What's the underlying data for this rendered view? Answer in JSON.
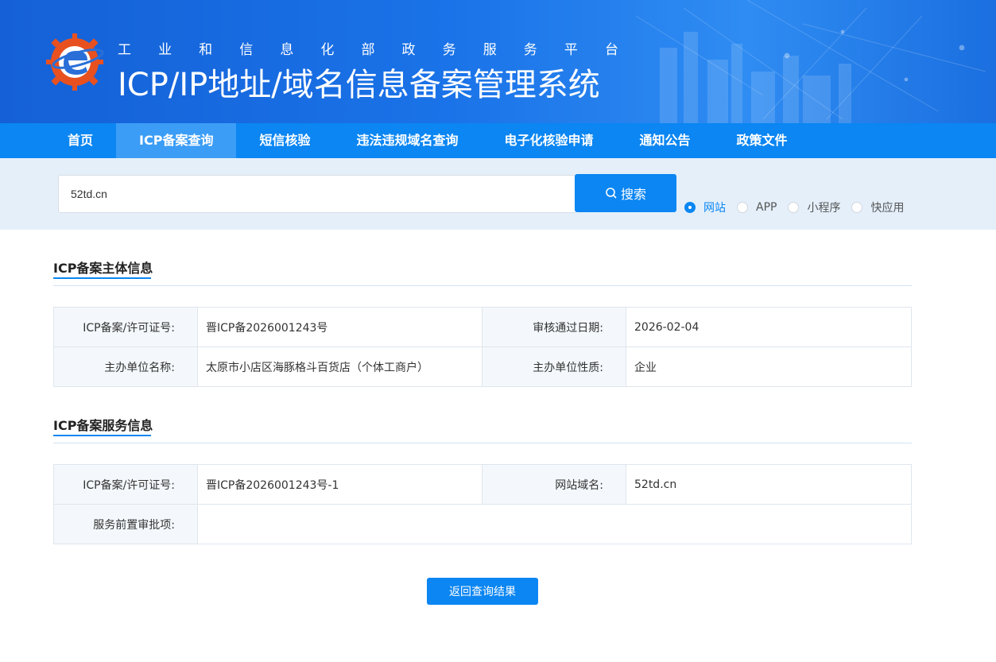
{
  "header": {
    "subtitle_chars": [
      "工",
      "业",
      "和",
      "信",
      "息",
      "化",
      "部",
      "政",
      "务",
      "服",
      "务",
      "平",
      "台"
    ],
    "title": "ICP/IP地址/域名信息备案管理系统"
  },
  "nav": {
    "items": [
      {
        "label": "首页",
        "active": false
      },
      {
        "label": "ICP备案查询",
        "active": true
      },
      {
        "label": "短信核验",
        "active": false
      },
      {
        "label": "违法违规域名查询",
        "active": false
      },
      {
        "label": "电子化核验申请",
        "active": false
      },
      {
        "label": "通知公告",
        "active": false
      },
      {
        "label": "政策文件",
        "active": false
      }
    ]
  },
  "search": {
    "value": "52td.cn",
    "button_label": "搜索",
    "options": [
      {
        "label": "网站",
        "checked": true
      },
      {
        "label": "APP",
        "checked": false
      },
      {
        "label": "小程序",
        "checked": false
      },
      {
        "label": "快应用",
        "checked": false
      }
    ]
  },
  "subject_section": {
    "title": "ICP备案主体信息",
    "license_label": "ICP备案/许可证号:",
    "license_value": "晋ICP备2026001243号",
    "date_label": "审核通过日期:",
    "date_value": "2026-02-04",
    "org_name_label": "主办单位名称:",
    "org_name_value": "太原市小店区海豚格斗百货店（个体工商户）",
    "org_type_label": "主办单位性质:",
    "org_type_value": "企业"
  },
  "service_section": {
    "title": "ICP备案服务信息",
    "license_label": "ICP备案/许可证号:",
    "license_value": "晋ICP备2026001243号-1",
    "domain_label": "网站域名:",
    "domain_value": "52td.cn",
    "preapproval_label": "服务前置审批项:",
    "preapproval_value": ""
  },
  "back_button_label": "返回查询结果",
  "colors": {
    "primary": "#0b86f2",
    "nav_active": "#3b9df6",
    "search_band": "#e4effa"
  }
}
